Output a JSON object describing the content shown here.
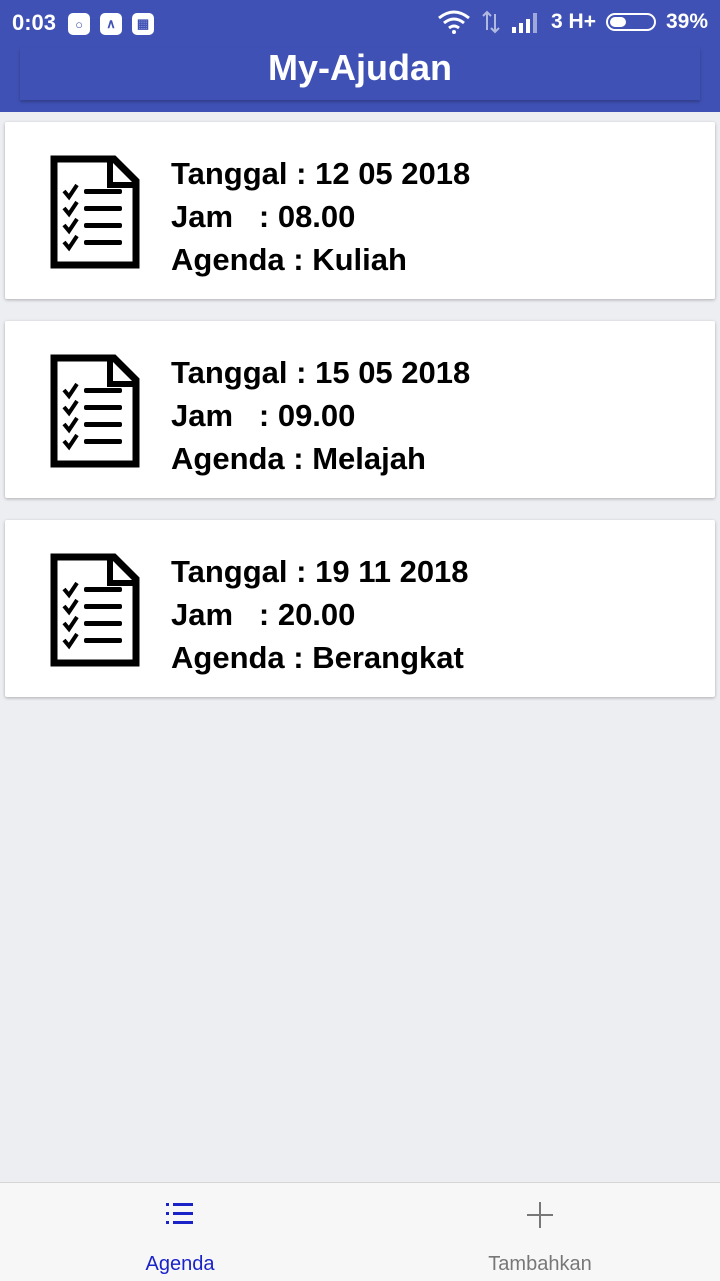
{
  "status_bar": {
    "time": "0:03",
    "network": "3 H+",
    "battery": "39%",
    "battery_level": 0.39
  },
  "app": {
    "title": "My-Ajudan"
  },
  "agenda_items": [
    {
      "tanggal_label": "Tanggal : ",
      "tanggal": "12 05 2018",
      "jam_label": "Jam   : ",
      "jam": "08.00",
      "agenda_label": "Agenda : ",
      "agenda": "Kuliah",
      "icon": "checklist-document-icon"
    },
    {
      "tanggal_label": "Tanggal : ",
      "tanggal": "15 05 2018",
      "jam_label": "Jam   : ",
      "jam": "09.00",
      "agenda_label": "Agenda : ",
      "agenda": "Melajah",
      "icon": "checklist-document-icon"
    },
    {
      "tanggal_label": "Tanggal : ",
      "tanggal": "19 11 2018",
      "jam_label": "Jam   : ",
      "jam": "20.00",
      "agenda_label": "Agenda : ",
      "agenda": "Berangkat",
      "icon": "checklist-document-icon"
    }
  ],
  "bottom_nav": {
    "items": [
      {
        "label": "Agenda",
        "icon": "list-icon",
        "active": true
      },
      {
        "label": "Tambahkan",
        "icon": "plus-icon",
        "active": false
      }
    ],
    "active_color": "#1a23c8",
    "inactive_color": "#777777"
  },
  "colors": {
    "primary": "#3f51b5",
    "background": "#edeef2"
  }
}
